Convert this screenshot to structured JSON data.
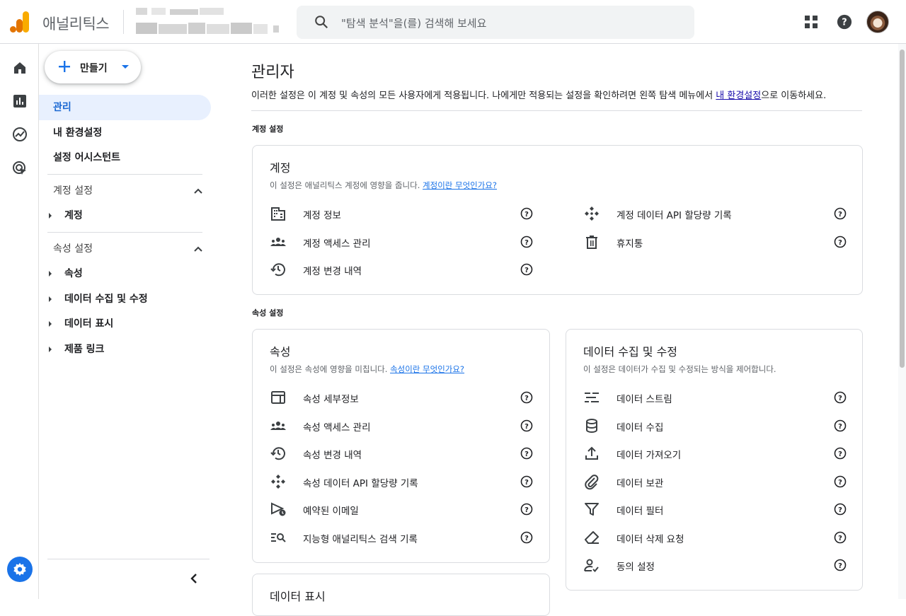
{
  "header": {
    "app_name": "애널리틱스",
    "search_placeholder": "\"탐색 분석\"을(를) 검색해 보세요"
  },
  "sidenav": {
    "create_label": "만들기",
    "items": [
      {
        "label": "관리",
        "active": true
      },
      {
        "label": "내 환경설정"
      },
      {
        "label": "설정 어시스턴트"
      }
    ],
    "account_section": {
      "label": "계정 설정",
      "children": [
        "계정"
      ]
    },
    "property_section": {
      "label": "속성 설정",
      "children": [
        "속성",
        "데이터 수집 및 수정",
        "데이터 표시",
        "제품 링크"
      ]
    }
  },
  "main": {
    "title": "관리자",
    "description_prefix": "이러한 설정은 이 계정 및 속성의 모든 사용자에게 적용됩니다. 나에게만 적용되는 설정을 확인하려면 왼쪽 탐색 메뉴에서 ",
    "description_link": "내 환경설정",
    "description_suffix": "으로 이동하세요.",
    "account_group_label": "계정 설정",
    "property_group_label": "속성 설정",
    "account_card": {
      "title": "계정",
      "desc": "이 설정은 애널리틱스 계정에 영향을 줍니다.",
      "desc_link": "계정이란 무엇인가요?",
      "left_items": [
        "계정 정보",
        "계정 액세스 관리",
        "계정 변경 내역"
      ],
      "right_items": [
        "계정 데이터 API 할당량 기록",
        "휴지통"
      ]
    },
    "property_card": {
      "title": "속성",
      "desc": "이 설정은 속성에 영향을 미칩니다.",
      "desc_link": "속성이란 무엇인가요?",
      "items": [
        "속성 세부정보",
        "속성 액세스 관리",
        "속성 변경 내역",
        "속성 데이터 API 할당량 기록",
        "예약된 이메일",
        "지능형 애널리틱스 검색 기록"
      ]
    },
    "data_card": {
      "title": "데이터 수집 및 수정",
      "desc": "이 설정은 데이터가 수집 및 수정되는 방식을 제어합니다.",
      "items": [
        "데이터 스트림",
        "데이터 수집",
        "데이터 가져오기",
        "데이터 보관",
        "데이터 필터",
        "데이터 삭제 요청",
        "동의 설정"
      ]
    },
    "display_card": {
      "title": "데이터 표시"
    }
  },
  "colors": {
    "accent": "#1a73e8",
    "active_bg": "#e8f0fe",
    "logo_orange": "#f9ab00",
    "logo_dark": "#e37400"
  }
}
